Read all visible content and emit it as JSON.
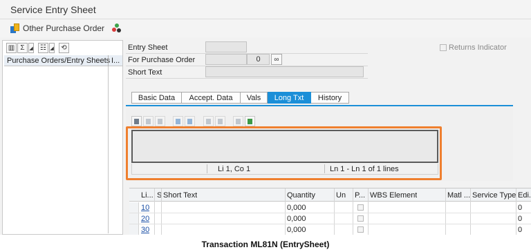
{
  "window": {
    "title": "Service Entry Sheet"
  },
  "toolbar": {
    "other_po_label": "Other Purchase Order"
  },
  "tree": {
    "header_col1": "Purchase Orders/Entry Sheets",
    "header_col2": "I..."
  },
  "form": {
    "entry_sheet_label": "Entry Sheet",
    "entry_sheet_value": "",
    "po_label": "For Purchase Order",
    "po_value": "",
    "po_item": "0",
    "short_text_label": "Short Text",
    "short_text_value": "",
    "returns_label": "Returns Indicator"
  },
  "tabs": [
    {
      "label": "Basic Data"
    },
    {
      "label": "Accept. Data"
    },
    {
      "label": "Vals"
    },
    {
      "label": "Long Txt",
      "active": true
    },
    {
      "label": "History"
    }
  ],
  "editor": {
    "content": "",
    "cursor_pos": "Li 1, Co 1",
    "line_info": "Ln 1 - Ln 1 of 1 lines"
  },
  "grid": {
    "columns": [
      "Li...",
      "S",
      "Short Text",
      "Quantity",
      "Un",
      "P...",
      "WBS Element",
      "Matl ...",
      "Service Type",
      "Edi..."
    ],
    "rows": [
      {
        "line": "10",
        "quantity": "0,000",
        "edition": "0"
      },
      {
        "line": "20",
        "quantity": "0,000",
        "edition": "0"
      },
      {
        "line": "30",
        "quantity": "0,000",
        "edition": "0"
      }
    ]
  },
  "caption": "Transaction ML81N (EntrySheet)",
  "colors": {
    "accent": "#1b8fd8",
    "highlight": "#ef7f2e"
  }
}
